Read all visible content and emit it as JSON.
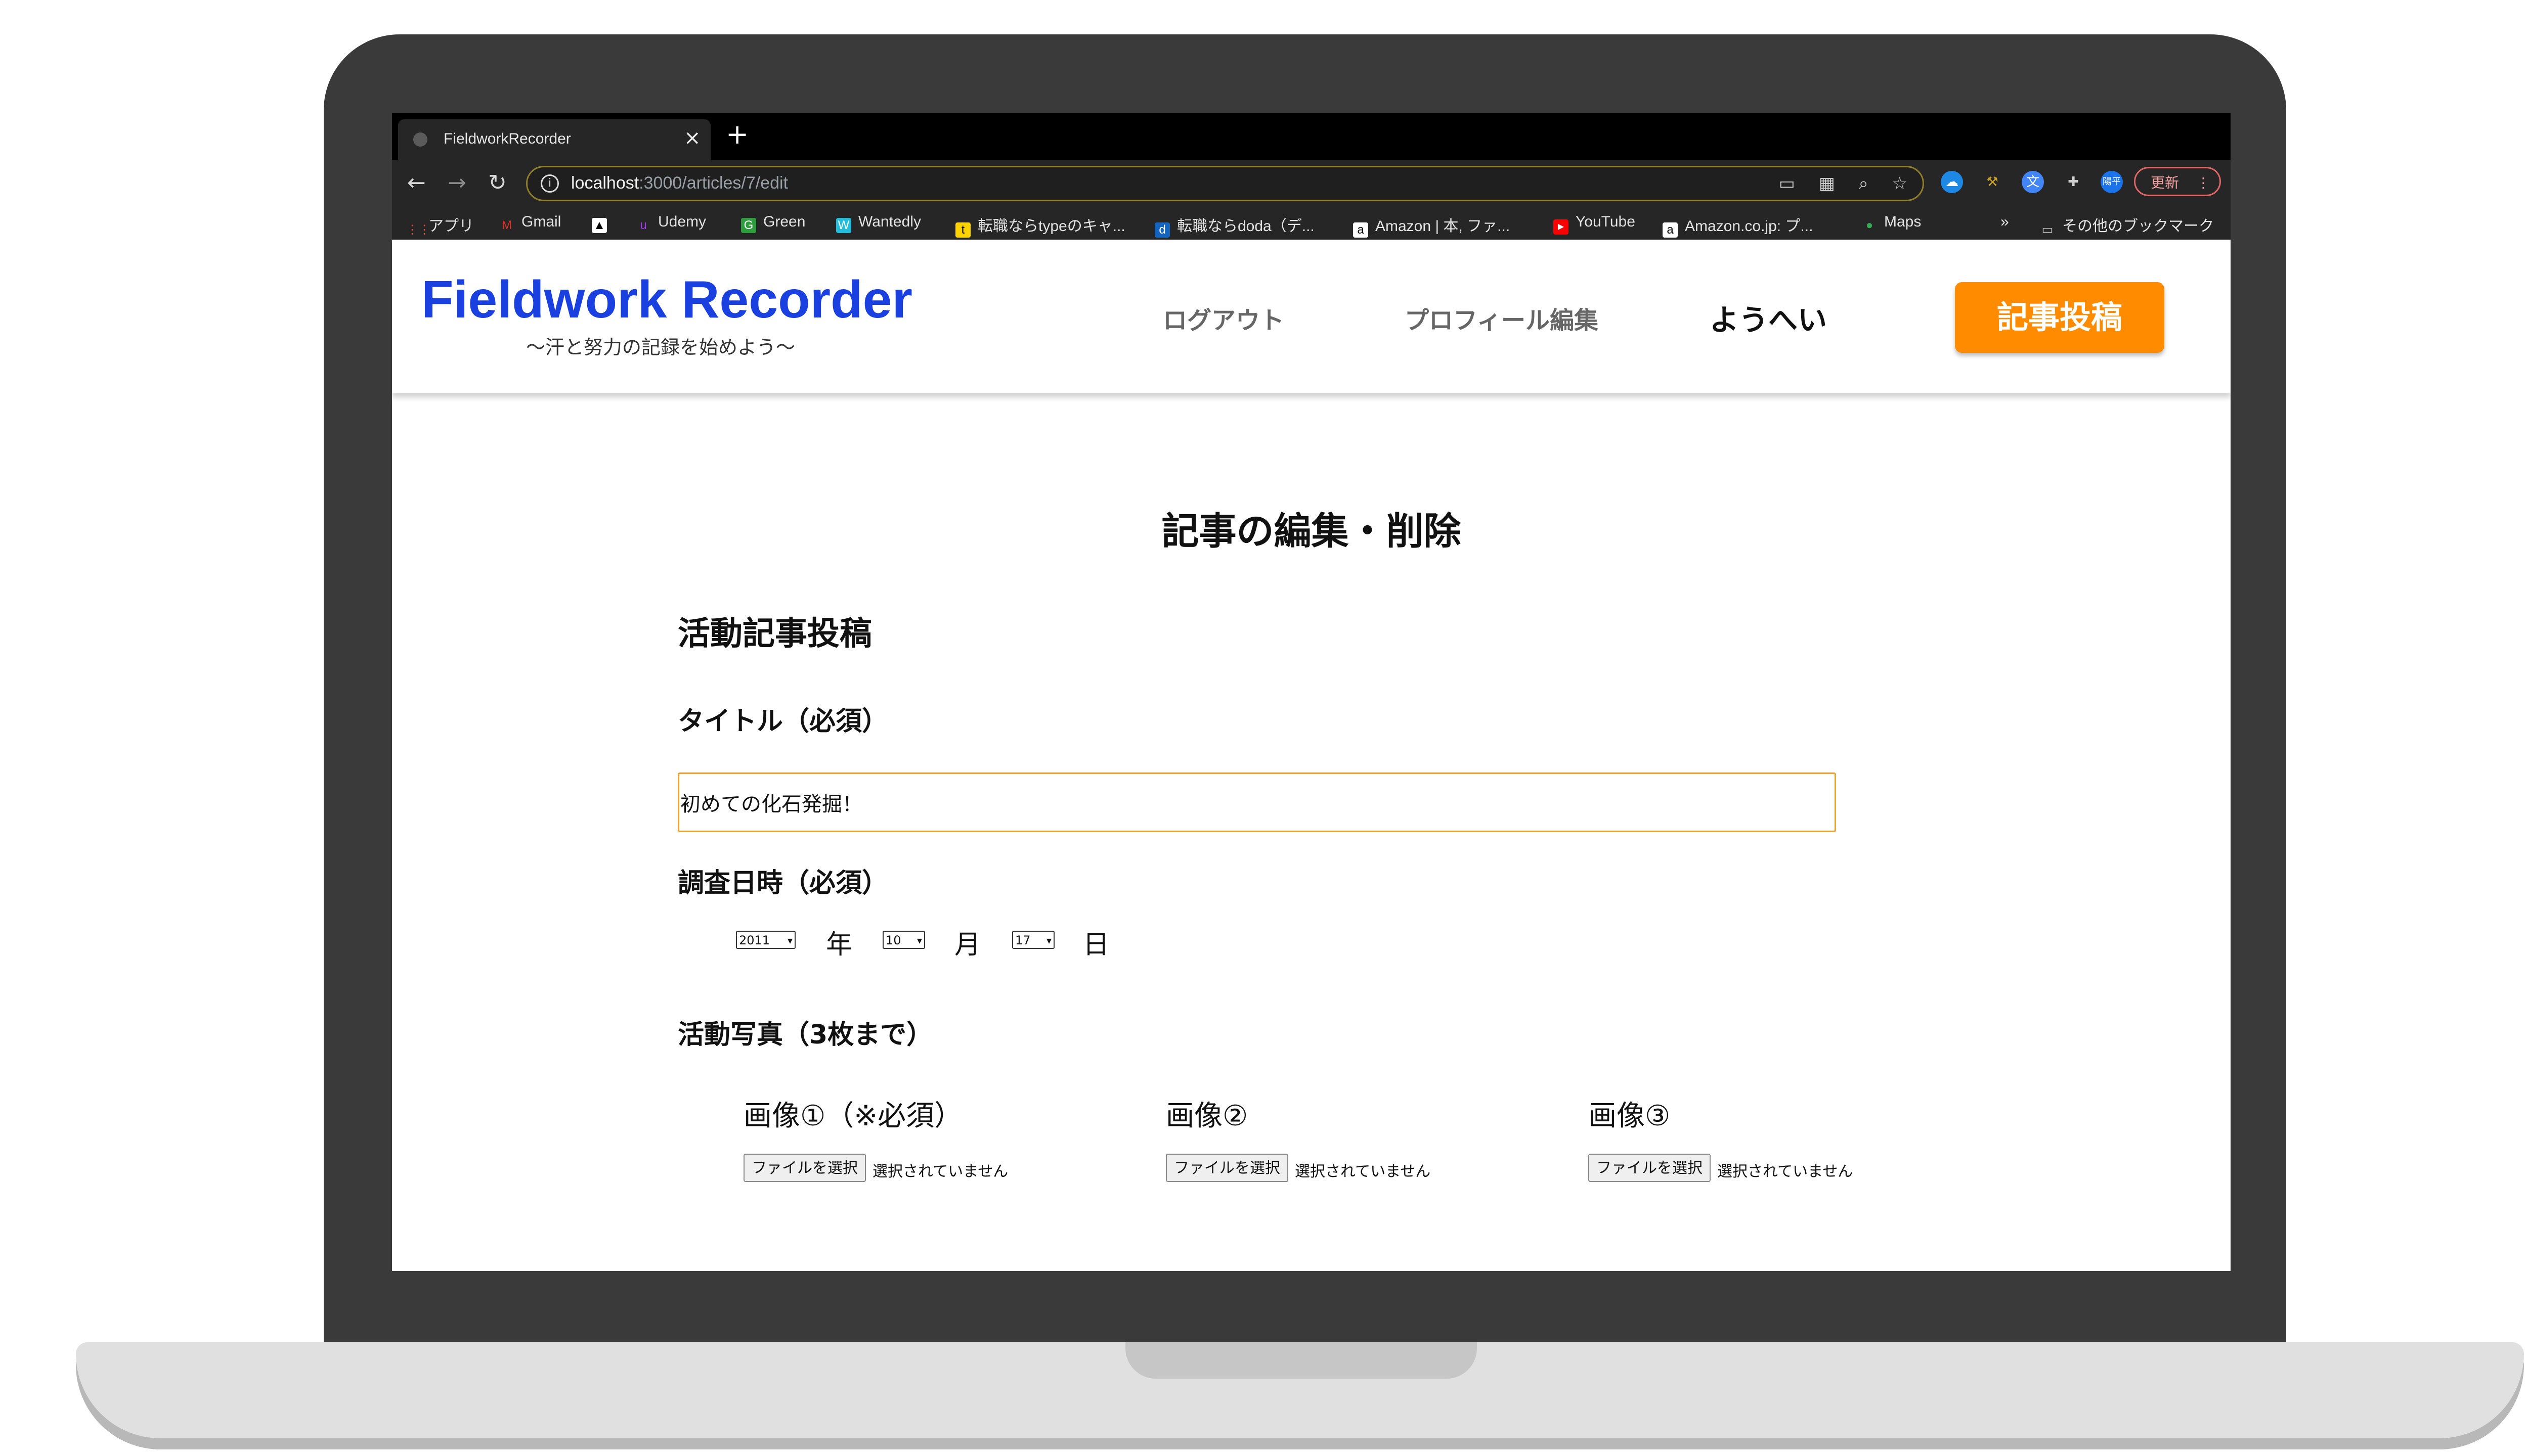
{
  "browser": {
    "tab_title": "FieldworkRecorder",
    "tab_close": "×",
    "new_tab": "+",
    "nav": {
      "back": "←",
      "forward": "→",
      "reload": "↻"
    },
    "url_host": "localhost",
    "url_path": ":3000/articles/7/edit",
    "omnibox_icons": [
      "cast-icon",
      "qr-icon",
      "zoom-icon",
      "star-icon"
    ],
    "extensions": [
      {
        "name": "cloud-extension-icon",
        "color": "#1e88e5",
        "glyph": "☁"
      },
      {
        "name": "tools-extension-icon",
        "color": "#c9a227",
        "glyph": "⚒"
      },
      {
        "name": "translate-extension-icon",
        "color": "#4285f4",
        "glyph": "文"
      },
      {
        "name": "puzzle-extensions-icon",
        "color": "#5f6368",
        "glyph": "✚"
      },
      {
        "name": "profile-avatar",
        "color": "#1a73e8",
        "glyph": "陽平"
      }
    ],
    "update_label": "更新",
    "more_glyph": "⋮",
    "bookmarks": [
      {
        "label": "アプリ",
        "icon": "apps-grid-icon",
        "color": "#d93025"
      },
      {
        "label": "Gmail",
        "icon": "gmail-icon",
        "color": "#d93025"
      },
      {
        "label": "",
        "icon": "atcoder-icon",
        "color": "#ffffff"
      },
      {
        "label": "Udemy",
        "icon": "udemy-icon",
        "color": "#a435f0"
      },
      {
        "label": "Green",
        "icon": "green-icon",
        "color": "#2e9d3e"
      },
      {
        "label": "Wantedly",
        "icon": "wantedly-icon",
        "color": "#21bddb"
      },
      {
        "label": "転職ならtypeのキャ...",
        "icon": "type-icon",
        "color": "#ffd200"
      },
      {
        "label": "転職ならdoda（デ...",
        "icon": "doda-icon",
        "color": "#1565c0"
      },
      {
        "label": "Amazon | 本, ファ...",
        "icon": "amazon-icon",
        "color": "#ffffff"
      },
      {
        "label": "YouTube",
        "icon": "youtube-icon",
        "color": "#ff0000"
      },
      {
        "label": "Amazon.co.jp: プ...",
        "icon": "amazon-icon",
        "color": "#ffffff"
      },
      {
        "label": "Maps",
        "icon": "maps-icon",
        "color": "#34a853"
      }
    ],
    "bookmarks_overflow": "»",
    "other_bookmarks": "その他のブックマーク"
  },
  "header": {
    "logo": "Fieldwork Recorder",
    "tagline": "〜汗と努力の記録を始めよう〜",
    "nav_logout": "ログアウト",
    "nav_profile": "プロフィール編集",
    "welcome": "ようへい",
    "post_button": "記事投稿"
  },
  "main": {
    "page_title": "記事の編集・削除",
    "section_title": "活動記事投稿",
    "title_label": "タイトル（必須）",
    "title_value": "初めての化石発掘！",
    "date_label": "調査日時（必須）",
    "year": "2011",
    "year_unit": "年",
    "month": "10",
    "month_unit": "月",
    "day": "17",
    "day_unit": "日",
    "photo_label": "活動写真（3枚まで）",
    "images": [
      {
        "label": "画像①（※必須）",
        "button": "ファイルを選択",
        "status": "選択されていません"
      },
      {
        "label": "画像②",
        "button": "ファイルを選択",
        "status": "選択されていません"
      },
      {
        "label": "画像③",
        "button": "ファイルを選択",
        "status": "選択されていません"
      }
    ]
  },
  "colors": {
    "logo": "#1a40e0",
    "accent": "#ff8c00",
    "input_border": "#f0a030"
  }
}
